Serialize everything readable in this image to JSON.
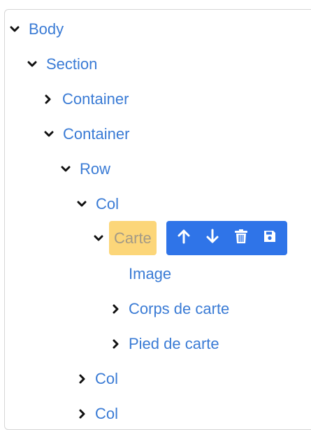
{
  "tree": {
    "body": "Body",
    "section": "Section",
    "container1": "Container",
    "container2": "Container",
    "row": "Row",
    "col1": "Col",
    "carte": "Carte",
    "image": "Image",
    "corps": "Corps de carte",
    "pied": "Pied de carte",
    "col2": "Col",
    "col3": "Col"
  },
  "toolbar": {
    "icons": [
      "arrow-up-icon",
      "arrow-down-icon",
      "trash-icon",
      "save-icon"
    ],
    "accent": "#2f74e8",
    "selected_bg": "#fcd679",
    "link_color": "#3a7bd5"
  }
}
